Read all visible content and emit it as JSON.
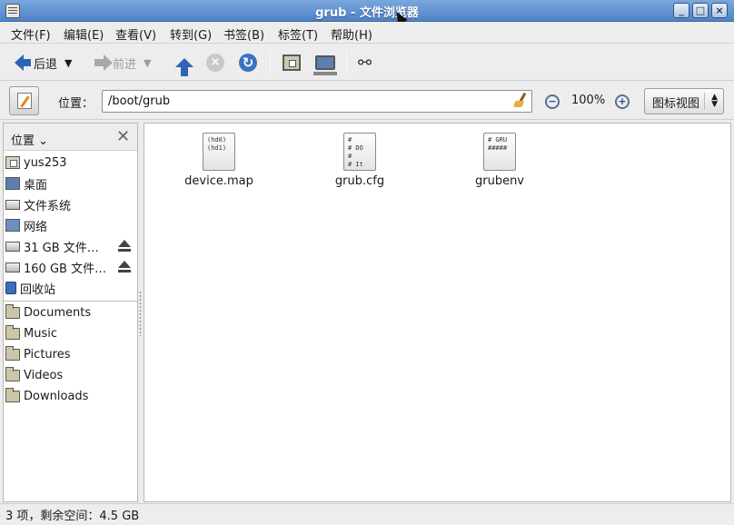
{
  "window": {
    "title": "grub - 文件浏览器"
  },
  "menu": [
    "文件(F)",
    "编辑(E)",
    "查看(V)",
    "转到(G)",
    "书签(B)",
    "标签(T)",
    "帮助(H)"
  ],
  "toolbar": {
    "back_label": "后退",
    "forward_label": "前进"
  },
  "location": {
    "label": "位置：",
    "path": "/boot/grub",
    "zoom": "100%",
    "view_mode": "图标视图"
  },
  "sidebar": {
    "header": "位置",
    "items": [
      {
        "label": "yus253",
        "icon": "home-folder-icon"
      },
      {
        "label": "桌面",
        "icon": "desktop-icon"
      },
      {
        "label": "文件系统",
        "icon": "drive-icon"
      },
      {
        "label": "网络",
        "icon": "network-icon"
      },
      {
        "label": "31 GB 文件…",
        "icon": "drive-icon",
        "eject": true
      },
      {
        "label": "160 GB 文件…",
        "icon": "drive-icon",
        "eject": true
      },
      {
        "label": "回收站",
        "icon": "trash-icon"
      }
    ],
    "bookmarks": [
      {
        "label": "Documents",
        "icon": "folder-icon"
      },
      {
        "label": "Music",
        "icon": "folder-icon"
      },
      {
        "label": "Pictures",
        "icon": "folder-icon"
      },
      {
        "label": "Videos",
        "icon": "folder-icon"
      },
      {
        "label": "Downloads",
        "icon": "folder-icon"
      }
    ]
  },
  "files": [
    {
      "name": "device.map",
      "preview": "(hd0)\n(hd1)"
    },
    {
      "name": "grub.cfg",
      "preview": "#\n# DO\n#\n# It"
    },
    {
      "name": "grubenv",
      "preview": "# GRU\n#####"
    }
  ],
  "status": {
    "text": "3 项，剩余空间：4.5 GB"
  },
  "colors": {
    "titlebar": "#4f83c6",
    "accent": "#2d64b6"
  }
}
